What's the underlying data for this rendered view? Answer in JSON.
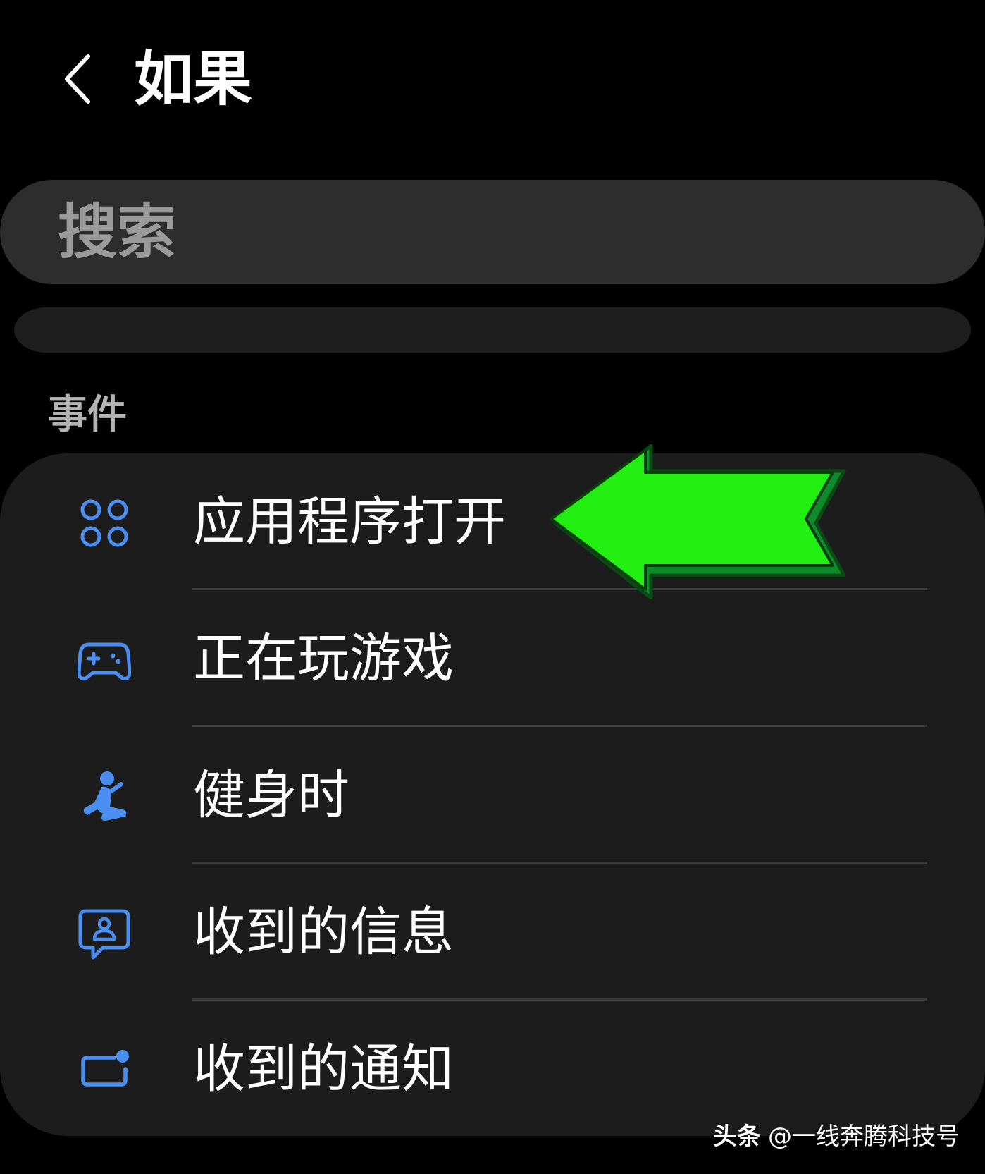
{
  "header": {
    "back_icon": "chevron-left-icon",
    "title": "如果"
  },
  "search": {
    "placeholder": "搜索"
  },
  "events_section": {
    "label": "事件",
    "items": [
      {
        "label": "应用程序打开",
        "icon": "apps-grid-icon"
      },
      {
        "label": "正在玩游戏",
        "icon": "gamepad-icon"
      },
      {
        "label": "健身时",
        "icon": "fitness-person-icon"
      },
      {
        "label": "收到的信息",
        "icon": "message-bubble-icon"
      },
      {
        "label": "收到的通知",
        "icon": "notification-badge-icon"
      }
    ]
  },
  "annotation": {
    "type": "arrow",
    "direction": "left",
    "color": "#22ee11",
    "points_to": "应用程序打开"
  },
  "watermark": {
    "brand": "头条",
    "handle": "@一线奔腾科技号"
  },
  "colors": {
    "background": "#000000",
    "card": "#1c1c1c",
    "search_bar": "#2d2d2d",
    "icon_accent": "#4a8ef0",
    "arrow": "#22ee11"
  }
}
